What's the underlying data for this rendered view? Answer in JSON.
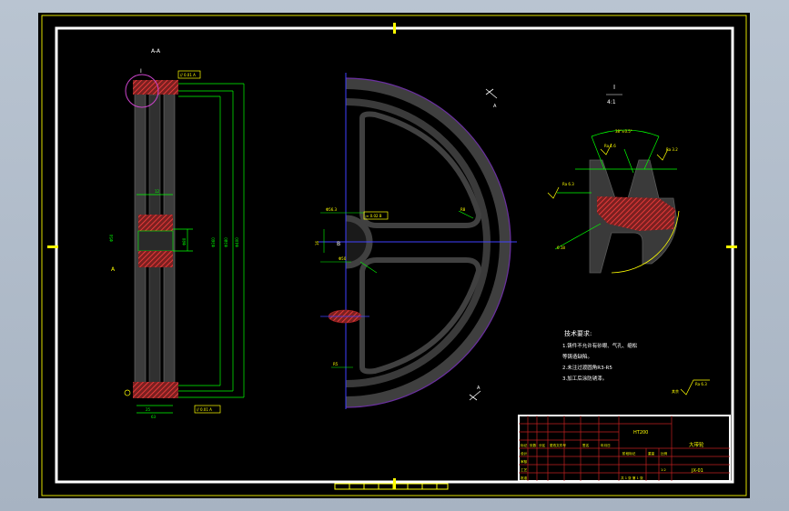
{
  "drawing": {
    "section_label": "A-A",
    "detail_label_number": "I",
    "detail_label_scale": "4:1",
    "view_arrow_label": "A",
    "side_view": {
      "flatness_callout_top": "// 0.01 A",
      "flatness_callout_bottom": "// 0.01 A",
      "datum_label": "A"
    },
    "detail_view": {
      "groove_angle": "38°±0.5°",
      "roughness_a": "Ra 1.6",
      "roughness_b": "Ra 3.2",
      "roughness_c": "Ra 6.3",
      "roughness_d": "Ra 12.5",
      "callout": "0.18"
    },
    "technical_requirements": {
      "title": "技术要求:",
      "lines": [
        "1.铸件不允许有砂眼、气孔、缩松",
        "等铸造缺陷。",
        "2.未注过渡圆角R3-R5",
        "3.加工后涂防锈漆。"
      ]
    },
    "other_roughness": "Ra 6.3",
    "title_block": {
      "part_name": "大带轮",
      "material": "HT200",
      "drawing_number": "JX-01",
      "headers": [
        "标记",
        "处数",
        "分区",
        "更改文件号",
        "签名",
        "年月日"
      ],
      "row_labels": [
        "设计",
        "审核",
        "工艺",
        "批准"
      ],
      "stage_label": "阶段标记",
      "weight_label": "重量",
      "scale_label": "比例",
      "scale_value": "1:2",
      "sheet_label": "共 1 张 第 1 张"
    }
  },
  "colors": {
    "background": "#000000",
    "border": "#ffffff",
    "frame_yellow": "#ffff00",
    "part_gray": "#404040",
    "hatch_red": "#cc3333",
    "dimension_green": "#00ff00",
    "centerline_blue": "#4040ff",
    "outline_magenta": "#cc44cc",
    "annotation_white": "#ffffff"
  }
}
